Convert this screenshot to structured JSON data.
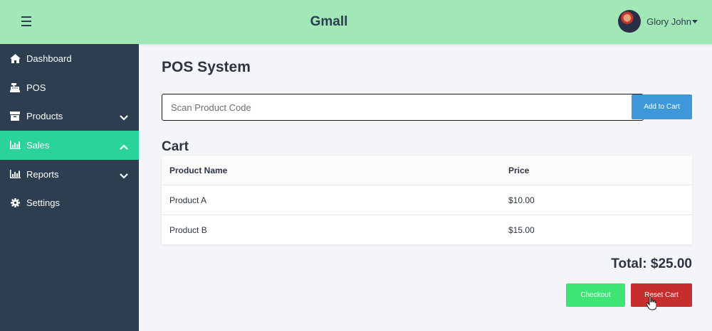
{
  "header": {
    "brand": "Gmall",
    "user_name": "Glory John",
    "menu_icon": "hamburger-icon",
    "avatar_icon": "user-avatar",
    "dropdown_icon": "caret-down-icon"
  },
  "sidebar": {
    "items": [
      {
        "label": "Dashboard",
        "icon": "home-icon",
        "active": false
      },
      {
        "label": "POS",
        "icon": "cash-register-icon",
        "active": false
      },
      {
        "label": "Products",
        "icon": "box-icon",
        "active": false,
        "expand": "chevron-down-icon"
      },
      {
        "label": "Sales",
        "icon": "bar-chart-icon",
        "active": true,
        "expand": "chevron-up-icon"
      },
      {
        "label": "Reports",
        "icon": "bar-chart-icon",
        "active": false,
        "expand": "chevron-down-icon"
      },
      {
        "label": "Settings",
        "icon": "gear-icon",
        "active": false
      }
    ],
    "active_color": "#2ad39b",
    "bg_color": "#2d3e50"
  },
  "main": {
    "title": "POS System",
    "scan": {
      "placeholder": "Scan Product Code",
      "value": ""
    },
    "add_button": "Add to Cart",
    "cart_title": "Cart",
    "table": {
      "headers": [
        "Product Name",
        "Price"
      ],
      "rows": [
        [
          "Product A",
          "$10.00"
        ],
        [
          "Product B",
          "$15.00"
        ]
      ]
    },
    "total": "Total: $25.00",
    "checkout_button": "Checkout",
    "reset_button": "Reset Cart"
  },
  "colors": {
    "header_bg": "#a1e8b6",
    "add_button": "#3d97d8",
    "checkout_button": "#3ee574",
    "reset_button": "#c62e2e"
  }
}
